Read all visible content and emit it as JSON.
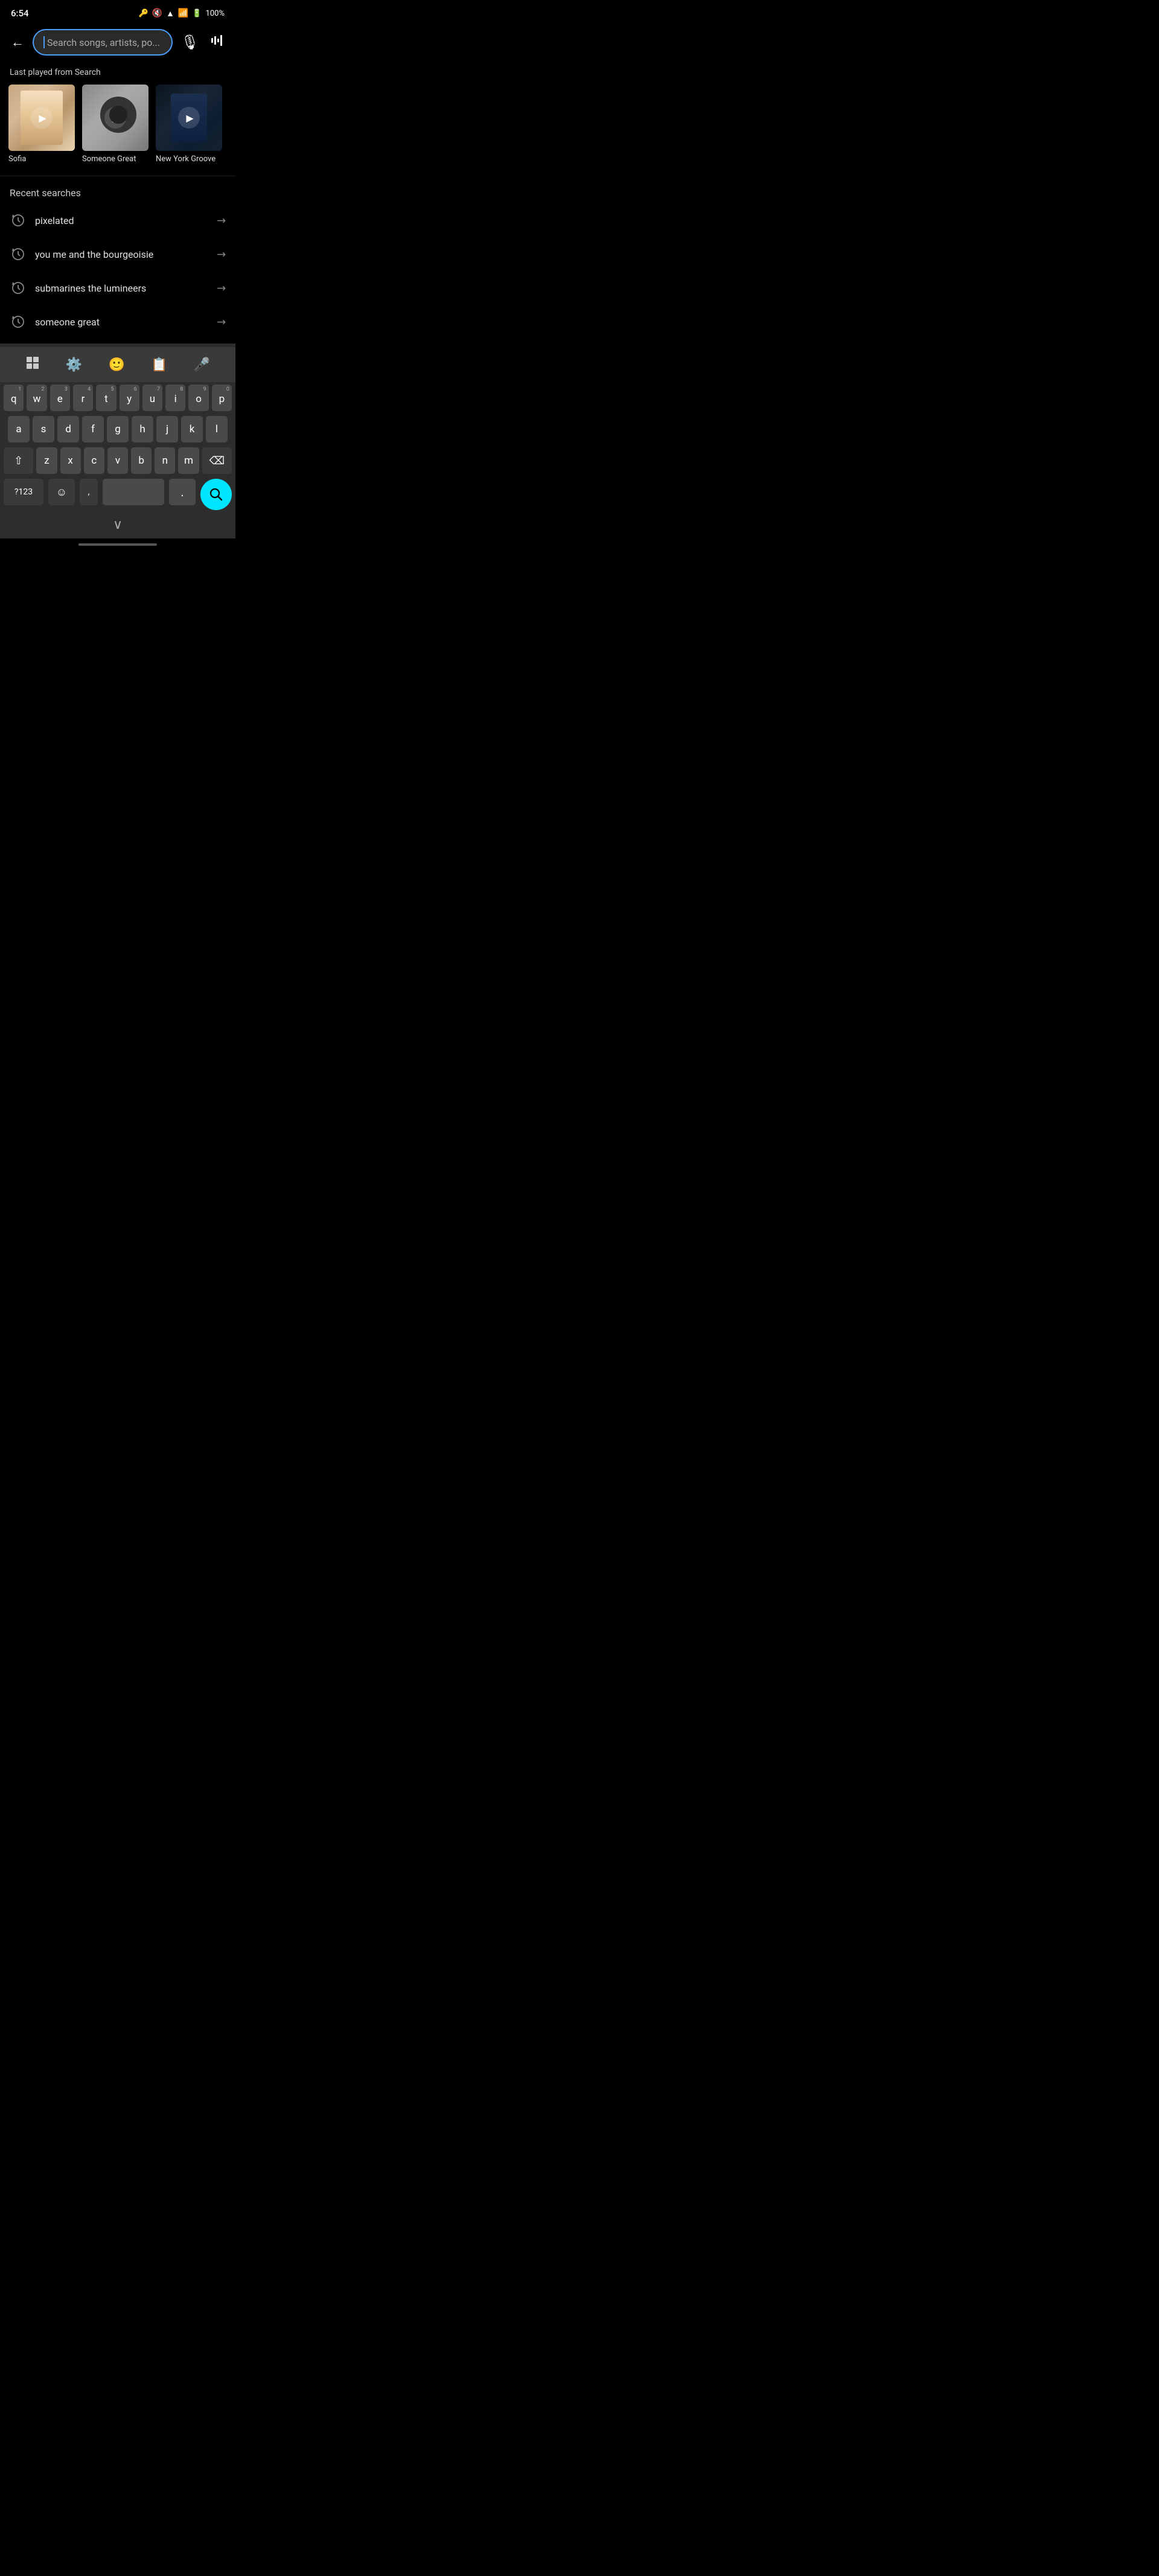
{
  "statusBar": {
    "time": "6:54",
    "battery": "100%"
  },
  "searchBar": {
    "placeholder": "Search songs, artists, po..."
  },
  "lastPlayed": {
    "label": "Last played from Search",
    "cards": [
      {
        "id": "sofia",
        "title": "Sofia",
        "thumbClass": "thumb-sofia"
      },
      {
        "id": "someone-great",
        "title": "Someone Great",
        "thumbClass": "thumb-someone-great"
      },
      {
        "id": "new-york-groove",
        "title": "New York Groove",
        "thumbClass": "thumb-new-york"
      }
    ]
  },
  "recentSearches": {
    "label": "Recent searches",
    "items": [
      {
        "id": "pixelated",
        "term": "pixelated"
      },
      {
        "id": "you-me",
        "term": "you me and the bourgeoisie"
      },
      {
        "id": "submarines",
        "term": "submarines the lumineers"
      },
      {
        "id": "someone-great",
        "term": "someone great"
      }
    ]
  },
  "keyboard": {
    "toolbar": {
      "apps": "⊞",
      "settings": "⚙",
      "emoji": "☺",
      "clipboard": "📋",
      "mic": "🎤"
    },
    "rows": {
      "numbers": [
        "1",
        "2",
        "3",
        "4",
        "5",
        "6",
        "7",
        "8",
        "9",
        "0"
      ],
      "top": [
        "q",
        "w",
        "e",
        "r",
        "t",
        "y",
        "u",
        "i",
        "o",
        "p"
      ],
      "middle": [
        "a",
        "s",
        "d",
        "f",
        "g",
        "h",
        "j",
        "k",
        "l"
      ],
      "bottom": [
        "z",
        "x",
        "c",
        "v",
        "b",
        "n",
        "m"
      ]
    },
    "specialKeys": {
      "shift": "⇧",
      "backspace": "⌫",
      "numbers": "?123",
      "emojiKey": "☺",
      "comma": ",",
      "period": ".",
      "search": "🔍",
      "collapse": "∨"
    }
  }
}
